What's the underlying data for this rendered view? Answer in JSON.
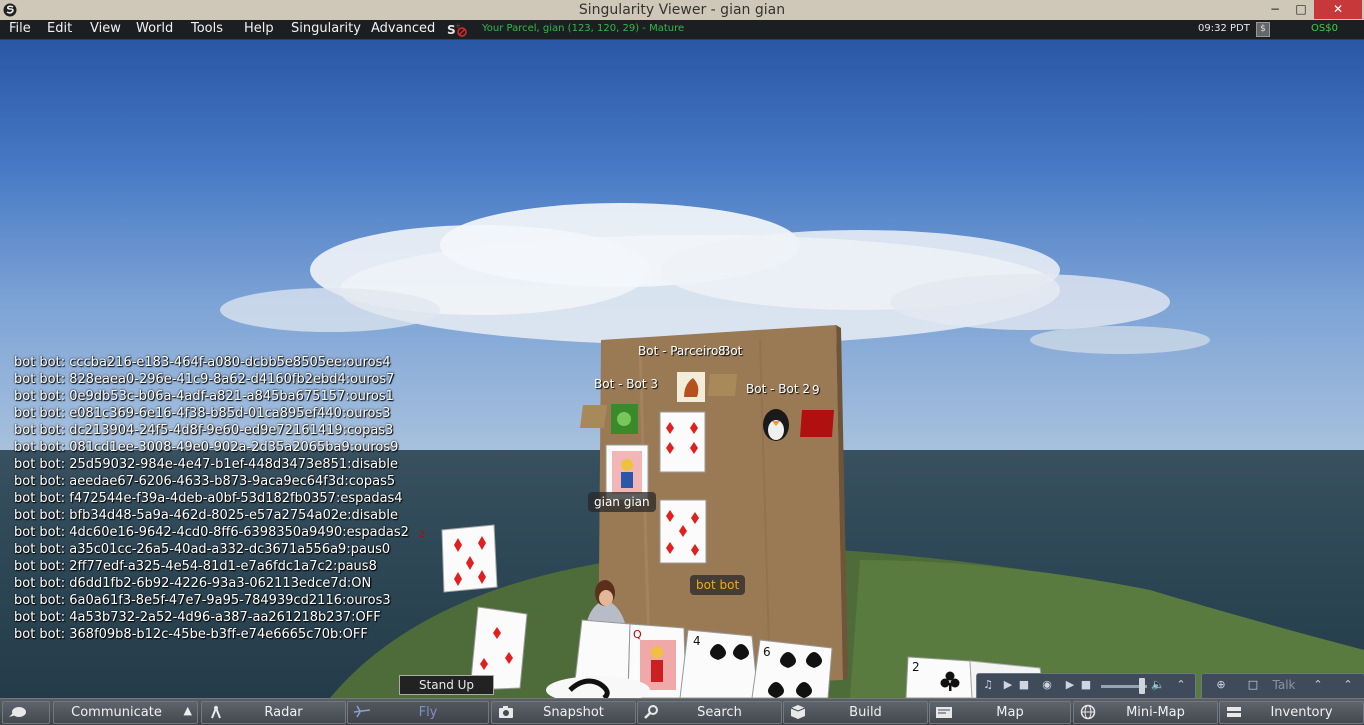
{
  "window": {
    "title": "Singularity Viewer - gian gian",
    "minimize": "−",
    "maximize": "□",
    "close": "✕"
  },
  "menu": {
    "items": [
      "File",
      "Edit",
      "View",
      "World",
      "Tools",
      "Help",
      "Singularity",
      "Advanced"
    ],
    "parcel_info": "Your Parcel, gian (123, 120, 29) - Mature",
    "clock": "09:32 PDT",
    "buy_currency": "$",
    "balance": "OS$0"
  },
  "chat": {
    "lines": [
      "bot bot: cccba216-e183-464f-a080-dcbb5e8505ee:ouros4",
      "bot bot: 828eaea0-296e-41c9-8a62-d4160fb2ebd4:ouros7",
      "bot bot: 0e9db53c-b06a-4adf-a821-a845ba675157:ouros1",
      "bot bot: e081c369-6e16-4f38-b85d-01ca895ef440:ouros3",
      "bot bot: dc213904-24f5-4d8f-9e60-ed9e72161419:copas3",
      "bot bot: 081cd1ee-3008-49e0-902a-2d35a2065ba9:ouros9",
      "bot bot: 25d59032-984e-4e47-b1ef-448d3473e851:disable",
      "bot bot: aeedae67-6206-4633-b873-9aca9ec64f3d:copas5",
      "bot bot: f472544e-f39a-4deb-a0bf-53d182fb0357:espadas4",
      "bot bot: bfb34d48-5a9a-462d-8025-e57a2754a02e:disable",
      "bot bot: 4dc60e16-9642-4cd0-8ff6-6398350a9490:espadas2",
      "bot bot: a35c01cc-26a5-40ad-a332-dc3671a556a9:paus0",
      "bot bot: 2ff77edf-a325-4e54-81d1-e7a6fdc1a7c2:paus8",
      "bot bot: d6dd1fb2-6b92-4226-93a3-062113edce7d:ON",
      "bot bot: 6a0a61f3-8e5f-47e7-9a95-784939cd2116:ouros3",
      "bot bot: 4a53b732-2a52-4d96-a387-aa261218b237:OFF",
      "bot bot: 368f09b8-b12c-45be-b3ff-e74e6665c70b:OFF"
    ]
  },
  "scene": {
    "seat_parceiro": "Bot - Parceiro Bot",
    "seat_bot3": "Bot - Bot 3",
    "seat_bot2": "Bot - Bot 2",
    "count_top": "8",
    "count_right": "9",
    "avatar_name_tag": "gian gian",
    "bot_name_tag": "bot bot",
    "hand_card_a": "2",
    "hand_card_b": "4",
    "hand_card_c": "6",
    "hand_card_d": "Q",
    "clubs_card": "2"
  },
  "controls": {
    "stand_up": "Stand Up",
    "talk": "Talk"
  },
  "toolbar": {
    "communicate": "Communicate",
    "radar": "Radar",
    "fly": "Fly",
    "snapshot": "Snapshot",
    "search": "Search",
    "build": "Build",
    "map": "Map",
    "minimap": "Mini-Map",
    "inventory": "Inventory"
  },
  "colors": {
    "parcel_text": "#33b84a",
    "balance_text": "#39d04a",
    "avatar_tag_text": "#ffffff",
    "bot_tag_text": "#f5a623",
    "close_button": "#c7383b",
    "card_red": "#e02020"
  }
}
